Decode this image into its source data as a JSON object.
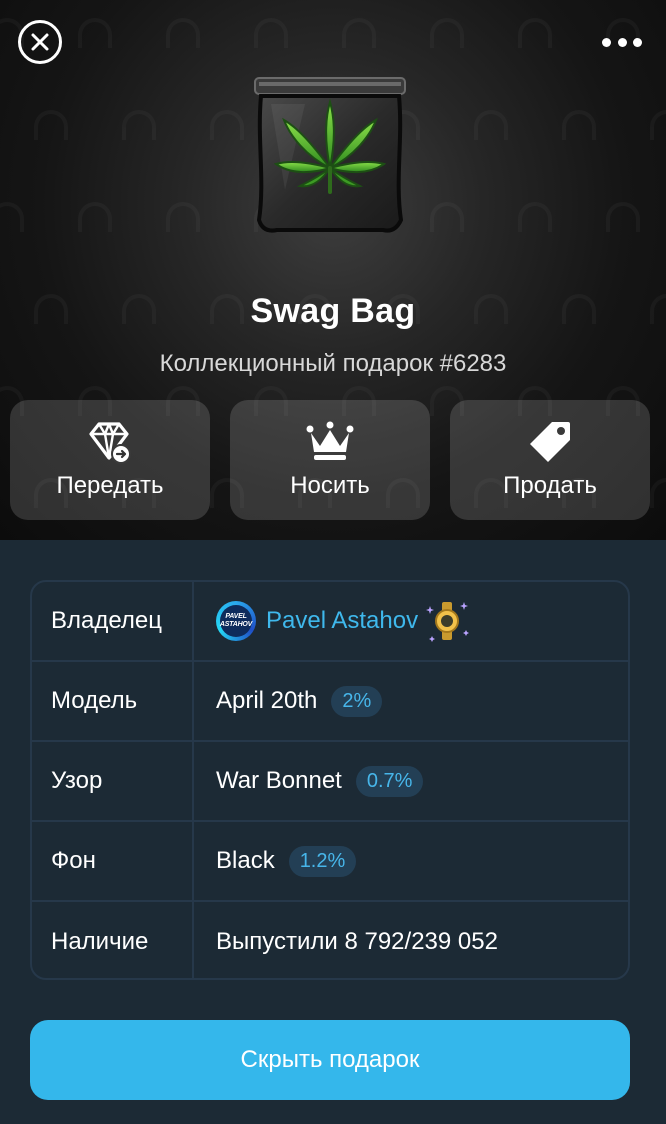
{
  "header": {
    "close_icon": "close-circle-icon",
    "more_icon": "more-horizontal-icon"
  },
  "gift": {
    "name": "Swag Bag",
    "subtitle": "Коллекционный подарок #6283",
    "image": "cannabis-bag-image"
  },
  "actions": [
    {
      "label": "Передать",
      "icon": "diamond-transfer-icon"
    },
    {
      "label": "Носить",
      "icon": "crown-icon"
    },
    {
      "label": "Продать",
      "icon": "price-tag-icon"
    }
  ],
  "details": {
    "owner": {
      "key": "Владелец",
      "name": "Pavel Astahov",
      "avatar_text_1": "PAVEL",
      "avatar_text_2": "ASTAHOV",
      "status_icon": "gold-watch-sparkle-icon"
    },
    "model": {
      "key": "Модель",
      "value": "April 20th",
      "badge": "2%"
    },
    "pattern": {
      "key": "Узор",
      "value": "War Bonnet",
      "badge": "0.7%"
    },
    "backdrop": {
      "key": "Фон",
      "value": "Black",
      "badge": "1.2%"
    },
    "availability": {
      "key": "Наличие",
      "value": "Выпустили 8 792/239 052"
    }
  },
  "footer": {
    "button_label": "Скрыть подарок"
  },
  "colors": {
    "accent": "#34b7eb",
    "link": "#3fb8ec",
    "panel_bg": "#1c2a35",
    "badge_bg": "#233f55",
    "badge_text": "#47b6ea"
  }
}
